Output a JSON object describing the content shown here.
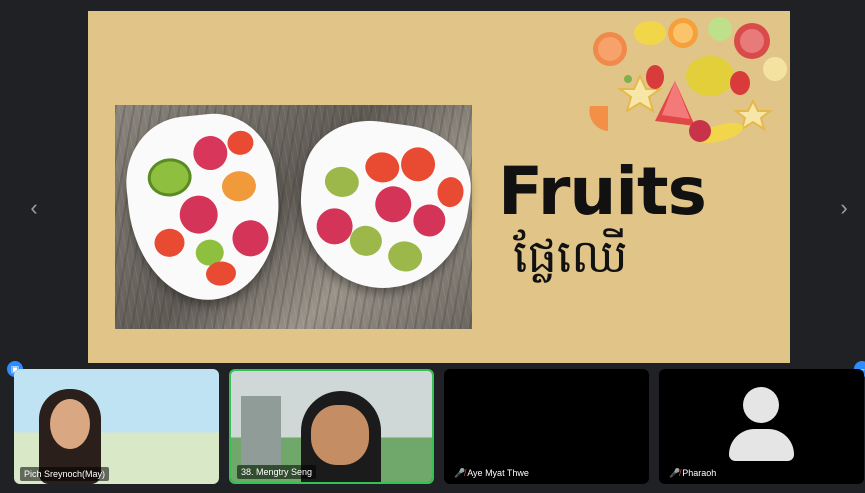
{
  "slide": {
    "title": "Fruits",
    "subtitle": "ផ្លែឈើ"
  },
  "navigation": {
    "prev_icon": "chevron-left-icon",
    "next_icon": "chevron-right-icon",
    "prev_glyph": "‹",
    "next_glyph": "›"
  },
  "participants": [
    {
      "name": "Pich Sreynoch(May)",
      "muted": false,
      "video": true
    },
    {
      "name": "38. Mengtry Seng",
      "muted": false,
      "video": true,
      "speaking": true
    },
    {
      "name": "Aye Myat Thwe",
      "muted": true,
      "video": false
    },
    {
      "name": "Pharaoh",
      "muted": true,
      "video": false
    }
  ],
  "colors": {
    "slide_background": "#e1c588",
    "active_speaker_border": "#35c253",
    "mic_off": "#e8453c",
    "badge": "#2d8cff"
  }
}
